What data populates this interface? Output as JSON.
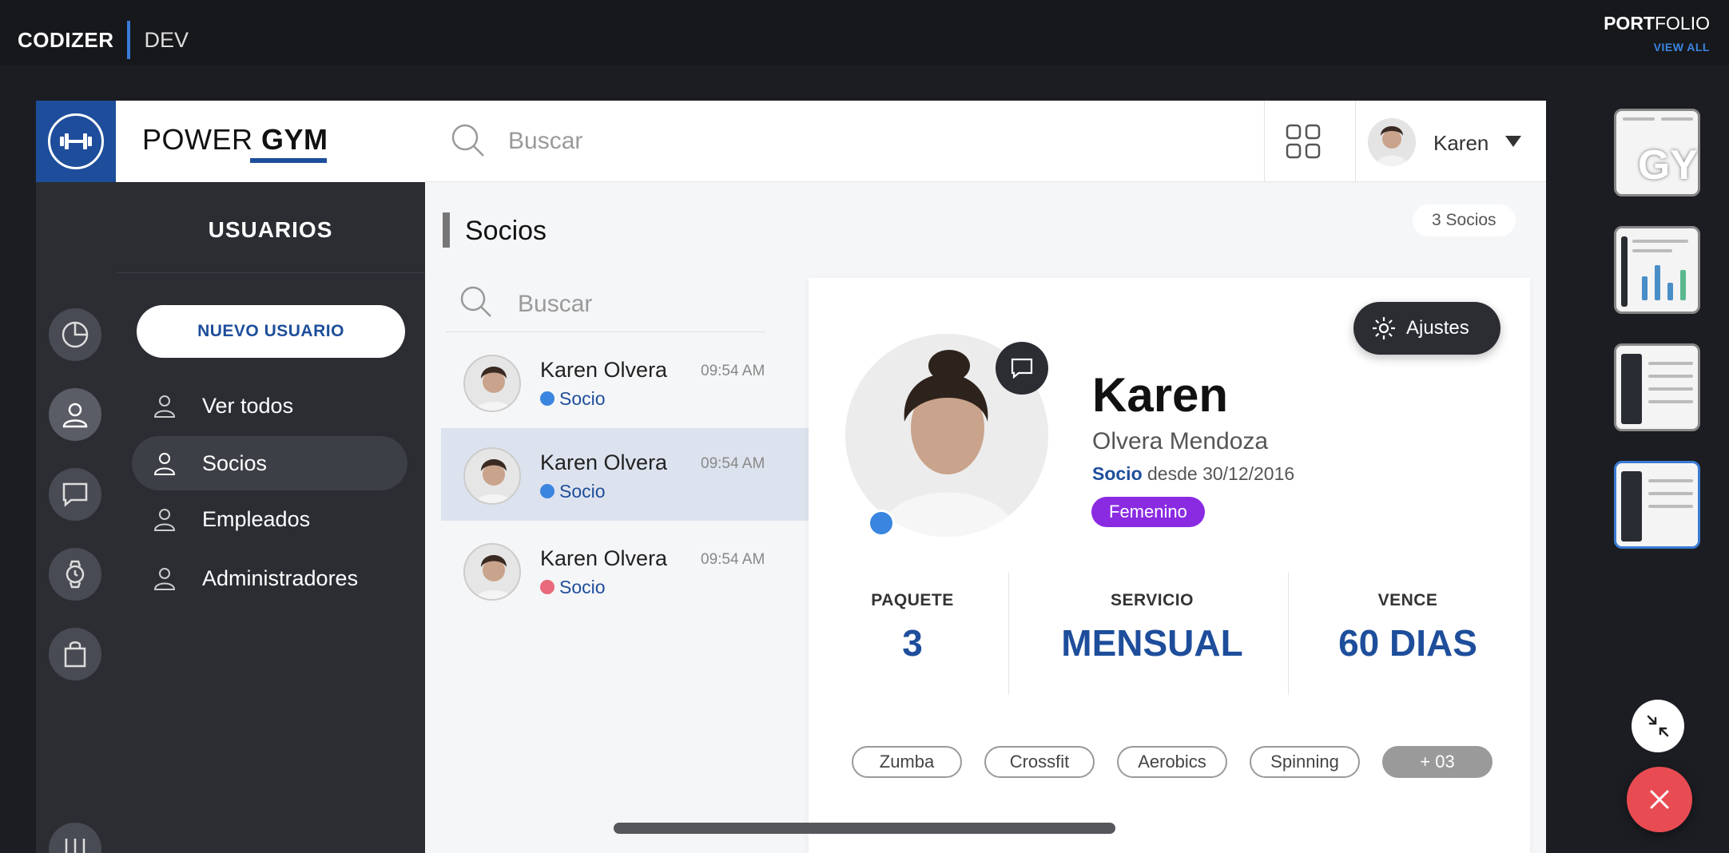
{
  "topbar": {
    "brand": "CODIZER",
    "env": "DEV",
    "portfolio_bold": "PORT",
    "portfolio_rest": "FOLIO",
    "view_all": "VIEW ALL"
  },
  "app": {
    "title_light": "POWER ",
    "title_bold": "GYM"
  },
  "menu": {
    "title": "USUARIOS",
    "new_user": "NUEVO USUARIO",
    "items": [
      {
        "label": "Ver todos"
      },
      {
        "label": "Socios"
      },
      {
        "label": "Empleados"
      },
      {
        "label": "Administradores"
      }
    ]
  },
  "search": {
    "placeholder": "Buscar"
  },
  "user": {
    "name": "Karen"
  },
  "list": {
    "title": "Socios",
    "count": "3 Socios",
    "search_placeholder": "Buscar",
    "rows": [
      {
        "name": "Karen Olvera",
        "time": "09:54 AM",
        "role": "Socio",
        "status_color": "#3a85e0"
      },
      {
        "name": "Karen Olvera",
        "time": "09:54 AM",
        "role": "Socio",
        "status_color": "#3a85e0"
      },
      {
        "name": "Karen Olvera",
        "time": "09:54 AM",
        "role": "Socio",
        "status_color": "#e86a7a"
      }
    ]
  },
  "profile": {
    "settings": "Ajustes",
    "first_name": "Karen",
    "last_name": "Olvera Mendoza",
    "role": "Socio",
    "since": "desde 30/12/2016",
    "gender": "Femenino",
    "stats": [
      {
        "label": "PAQUETE",
        "value": "3"
      },
      {
        "label": "SERVICIO",
        "value": "MENSUAL"
      },
      {
        "label": "VENCE",
        "value": "60 DIAS"
      }
    ],
    "classes": [
      "Zumba",
      "Crossfit",
      "Aerobics",
      "Spinning"
    ],
    "more_classes": "+ 03"
  },
  "colors": {
    "accent": "#1e4e9b",
    "gender_tag": "#8a2be2",
    "close": "#e84c52"
  }
}
